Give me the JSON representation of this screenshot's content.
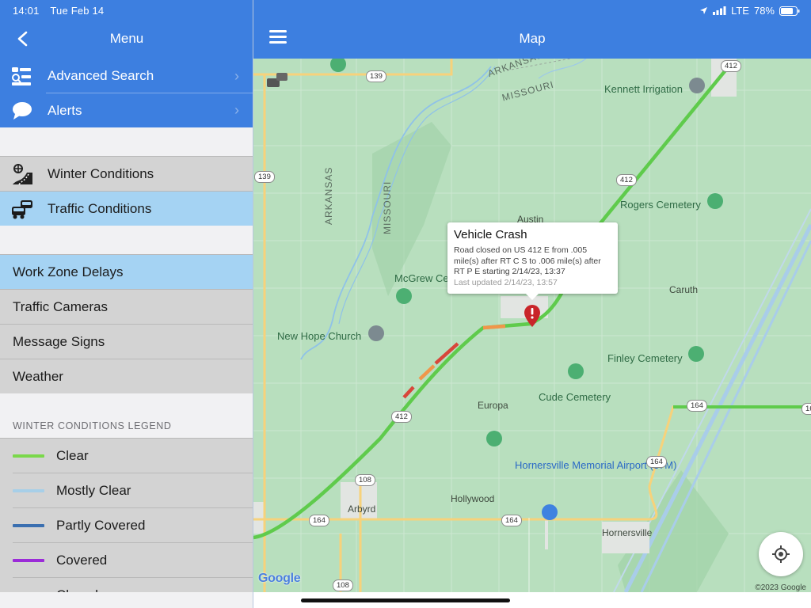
{
  "status_bar": {
    "time": "14:01",
    "date": "Tue Feb 14",
    "network": "LTE",
    "battery": "78%"
  },
  "sidebar": {
    "title": "Menu",
    "nav_items": [
      {
        "label": "Advanced Search",
        "icon": "advanced-search-icon"
      },
      {
        "label": "Alerts",
        "icon": "speech-bubble-icon"
      }
    ],
    "layer_items": [
      {
        "label": "Winter Conditions",
        "icon": "snowflake-road-icon",
        "selected": false
      },
      {
        "label": "Traffic Conditions",
        "icon": "traffic-cars-icon",
        "selected": true
      }
    ],
    "toggle_items": [
      {
        "label": "Work Zone Delays",
        "selected": true
      },
      {
        "label": "Traffic Cameras",
        "selected": false
      },
      {
        "label": "Message Signs",
        "selected": false
      },
      {
        "label": "Weather",
        "selected": false
      }
    ],
    "legend_title": "WINTER CONDITIONS LEGEND",
    "legend": [
      {
        "label": "Clear",
        "color": "#7ad84a"
      },
      {
        "label": "Mostly Clear",
        "color": "#a7cfe8"
      },
      {
        "label": "Partly Covered",
        "color": "#3a6fb0"
      },
      {
        "label": "Covered",
        "color": "#9b2bd8"
      },
      {
        "label": "Closed",
        "color": "#1b1b1b"
      }
    ]
  },
  "map": {
    "title": "Map",
    "popup": {
      "title": "Vehicle Crash",
      "body": "Road closed on US 412 E from .005 mile(s) after RT C S to .006 mile(s) after RT P E starting 2/14/23, 13:37",
      "updated": "Last updated 2/14/23, 13:57"
    },
    "places": {
      "kennett_irrigation": "Kennett Irrigation",
      "rogers_cemetery": "Rogers Cemetery",
      "austin": "Austin",
      "mcgrew": "McGrew Ce",
      "new_hope": "New Hope Church",
      "caruth": "Caruth",
      "finley": "Finley Cemetery",
      "cude": "Cude Cemetery",
      "europa": "Europa",
      "hornersville_airport": "Hornersville Memorial Airport (37M)",
      "hollywood": "Hollywood",
      "arbyrd": "Arbyrd",
      "hornersville": "Hornersville",
      "arkansas_top": "ARKANSAS",
      "missouri_top": "MISSOURI",
      "arkansas_v": "ARKANSAS",
      "missouri_v": "MISSOURI"
    },
    "shields": {
      "r139a": "139",
      "r139b": "139",
      "r412a": "412",
      "r412b": "412",
      "r412c": "412",
      "r108a": "108",
      "r108b": "108",
      "r164a": "164",
      "r164b": "164",
      "r164c": "164",
      "r164d": "164",
      "r16": "16"
    },
    "google_logo": "Google",
    "copyright": "©2023 Google"
  }
}
